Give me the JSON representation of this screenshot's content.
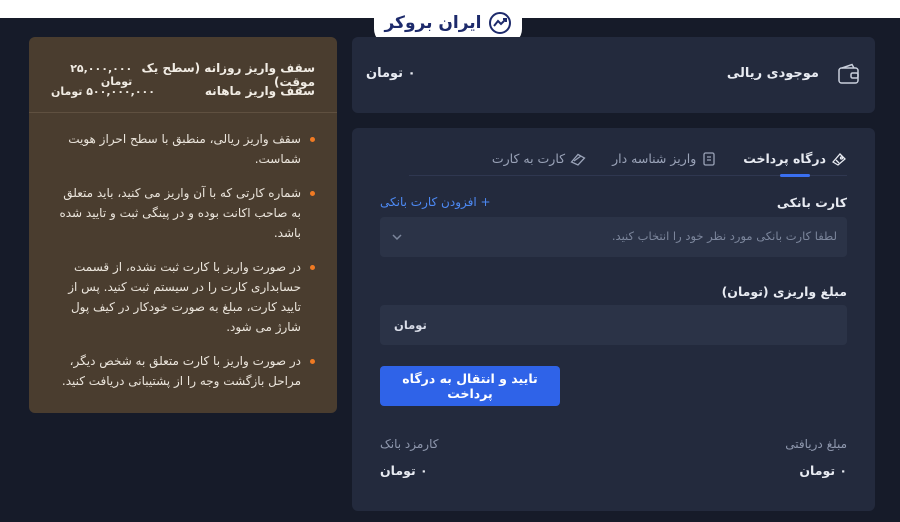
{
  "brand": {
    "logo_text": "ایران بروکر"
  },
  "balance": {
    "label": "موجودی ریالی",
    "value": "۰ تومان"
  },
  "tabs": [
    {
      "label": "درگاه پرداخت",
      "icon": "gateway-icon",
      "active": true
    },
    {
      "label": "واریز شناسه دار",
      "icon": "id-deposit-icon",
      "active": false
    },
    {
      "label": "کارت به کارت",
      "icon": "card-transfer-icon",
      "active": false
    }
  ],
  "form": {
    "card_label": "کارت بانکی",
    "add_card_label": "+ افزودن کارت بانکی",
    "card_placeholder": "لطفا کارت بانکی مورد نظر خود را انتخاب کنید.",
    "amount_label": "مبلغ واریزی (تومان)",
    "amount_unit": "تومان",
    "submit_label": "تایید و انتقال به درگاه پرداخت"
  },
  "summary": {
    "received_label": "مبلغ دریافتی",
    "received_value": "۰ تومان",
    "fee_label": "کارمزد بانک",
    "fee_value": "۰ تومان"
  },
  "limits": {
    "daily_label": "سقف واریز روزانه (سطح یک موقت)",
    "daily_value": "۲۵,۰۰۰,۰۰۰ تومان",
    "monthly_label": "سقف واریز ماهانه",
    "monthly_value": "۵۰۰,۰۰۰,۰۰۰ تومان"
  },
  "notes": [
    "سقف واریز ریالی، منطبق با سطح احراز هویت شماست.",
    "شماره کارتی که با آن واریز می کنید، باید متعلق به صاحب اکانت بوده و در پینگی ثبت و تایید شده باشد.",
    "در صورت واریز با کارت ثبت نشده، از قسمت حسابداری کارت را در سیستم ثبت کنید. پس از تایید کارت، مبلغ به صورت خودکار در کیف پول شارژ می شود.",
    "در صورت واریز با کارت متعلق به شخص دیگر، مراحل بازگشت وجه را از پشتیبانی دریافت کنید."
  ],
  "colors": {
    "accent": "#2f63e8",
    "link": "#4d8af5",
    "bullet": "#f07a23",
    "info_bg": "#4a3d2f",
    "card_bg": "#232a3d",
    "page_bg": "#161b29"
  }
}
